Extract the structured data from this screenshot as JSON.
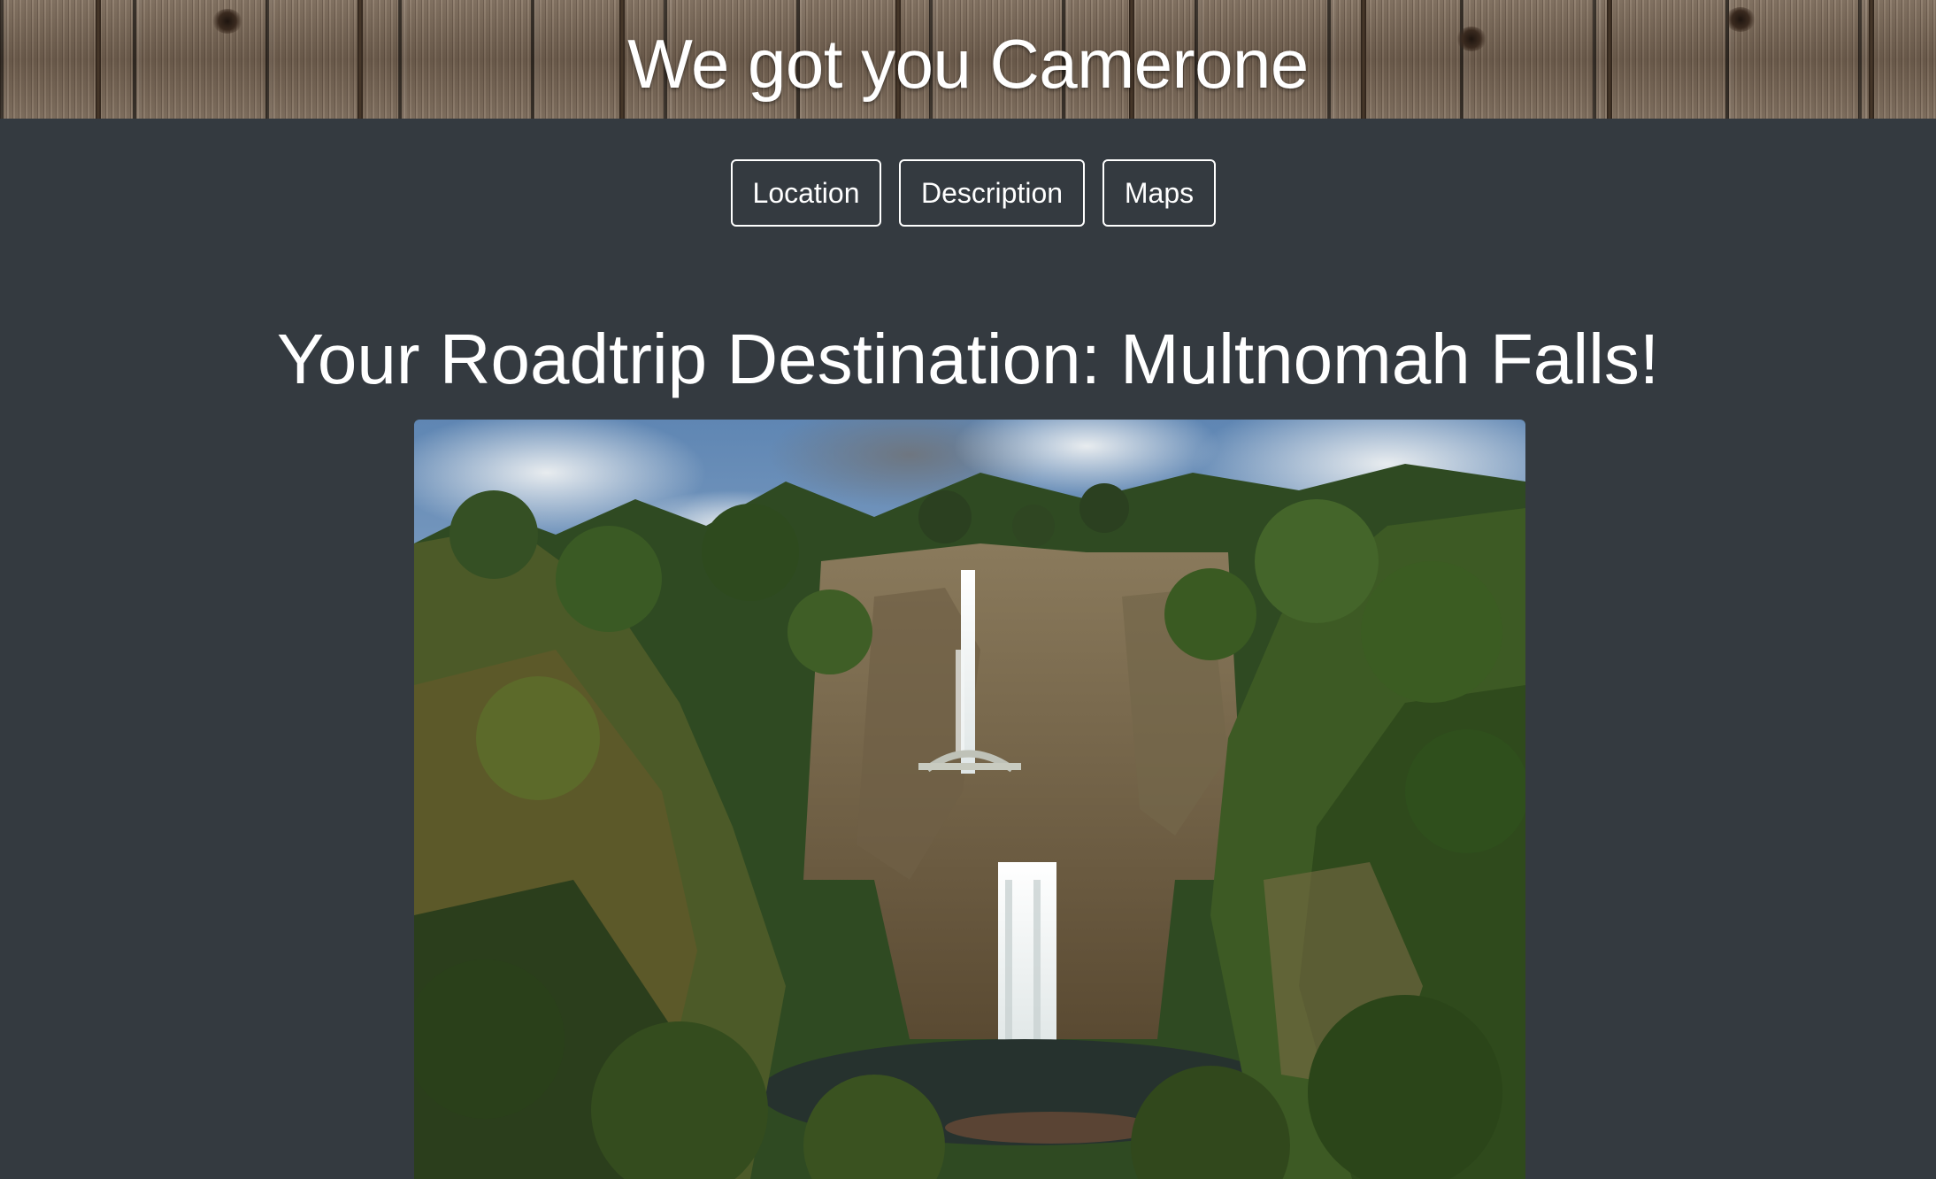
{
  "header": {
    "title": "We got you Camerone"
  },
  "nav": {
    "buttons": [
      {
        "label": "Location"
      },
      {
        "label": "Description"
      },
      {
        "label": "Maps"
      }
    ]
  },
  "main": {
    "title": "Your Roadtrip Destination: Multnomah Falls!"
  },
  "colors": {
    "background": "#343a40",
    "text": "#ffffff",
    "button_border": "#ffffff"
  },
  "icons": []
}
